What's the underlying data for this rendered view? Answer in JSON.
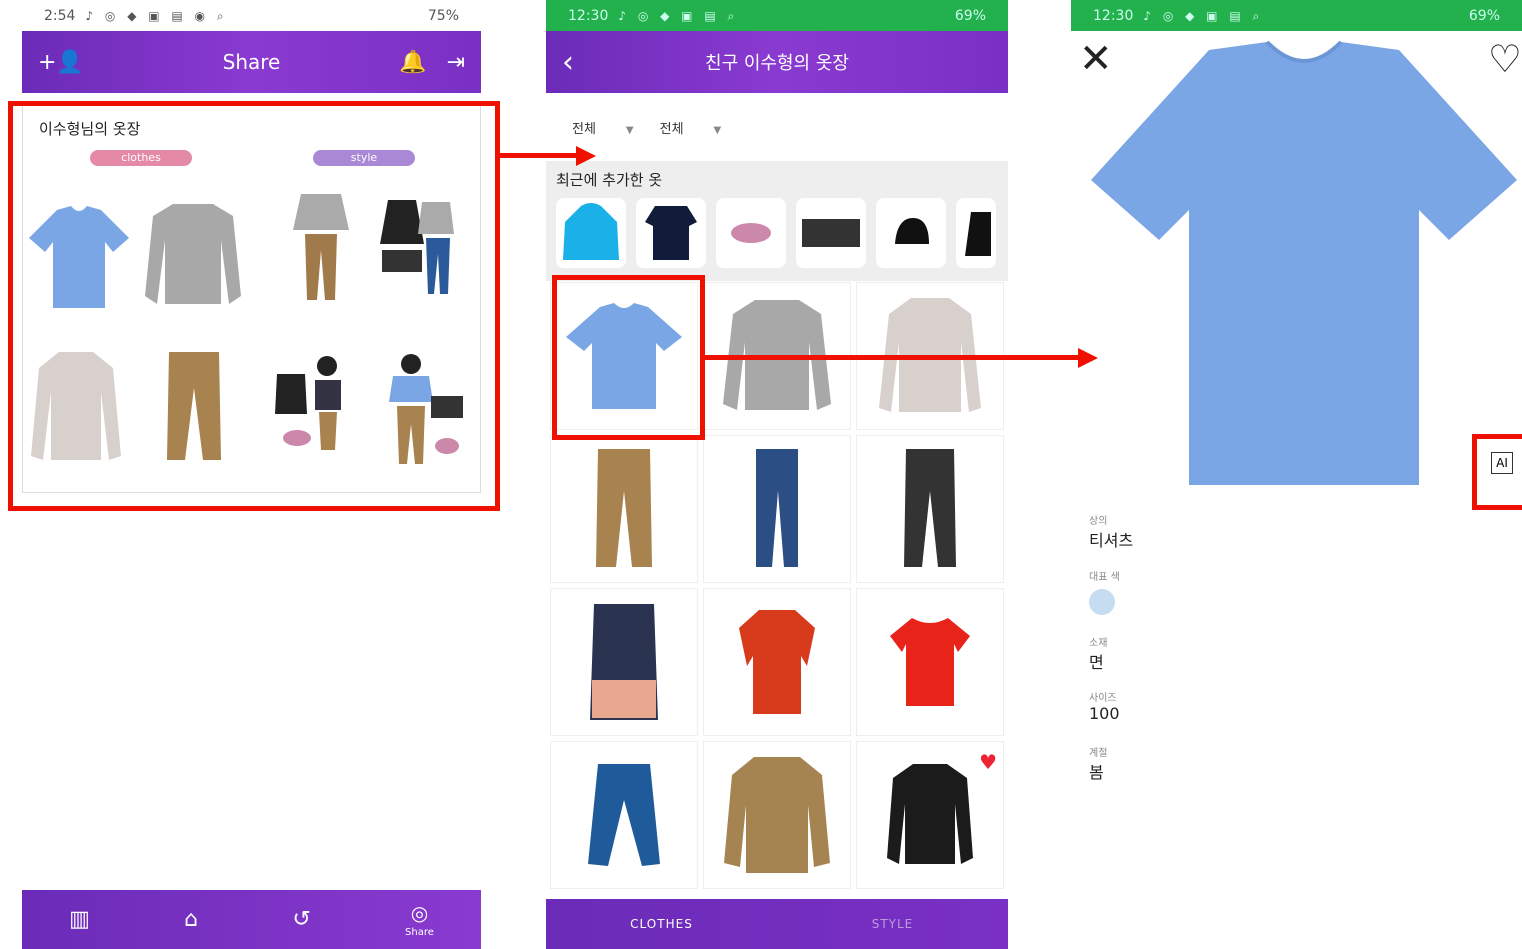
{
  "screen1": {
    "status": {
      "time": "2:54",
      "right": "75%"
    },
    "appbar": {
      "title": "Share"
    },
    "card": {
      "owner": "이수형님의 옷장",
      "pill_clothes": "clothes",
      "pill_style": "style"
    },
    "nav": {
      "share_label": "Share"
    }
  },
  "screen2": {
    "status": {
      "time": "12:30",
      "right": "69%"
    },
    "appbar": {
      "title": "친구 이수형의 옷장"
    },
    "filters": [
      "전체",
      "전체"
    ],
    "recent_label": "최근에 추가한 옷",
    "tabs": {
      "clothes": "CLOTHES",
      "style": "STYLE"
    }
  },
  "screen3": {
    "status": {
      "time": "12:30",
      "right": "69%"
    },
    "attrs": {
      "category_k": "상의",
      "category_v": "티셔츠",
      "color_k": "대표 색",
      "material_k": "소재",
      "material_v": "면",
      "size_k": "사이즈",
      "size_v": "100",
      "season_k": "계절",
      "season_v": "봄"
    },
    "ai_label": "AI"
  },
  "colors": {
    "purple": "#7a30c4",
    "red": "#e10000",
    "shirt": "#7aa6e6"
  }
}
